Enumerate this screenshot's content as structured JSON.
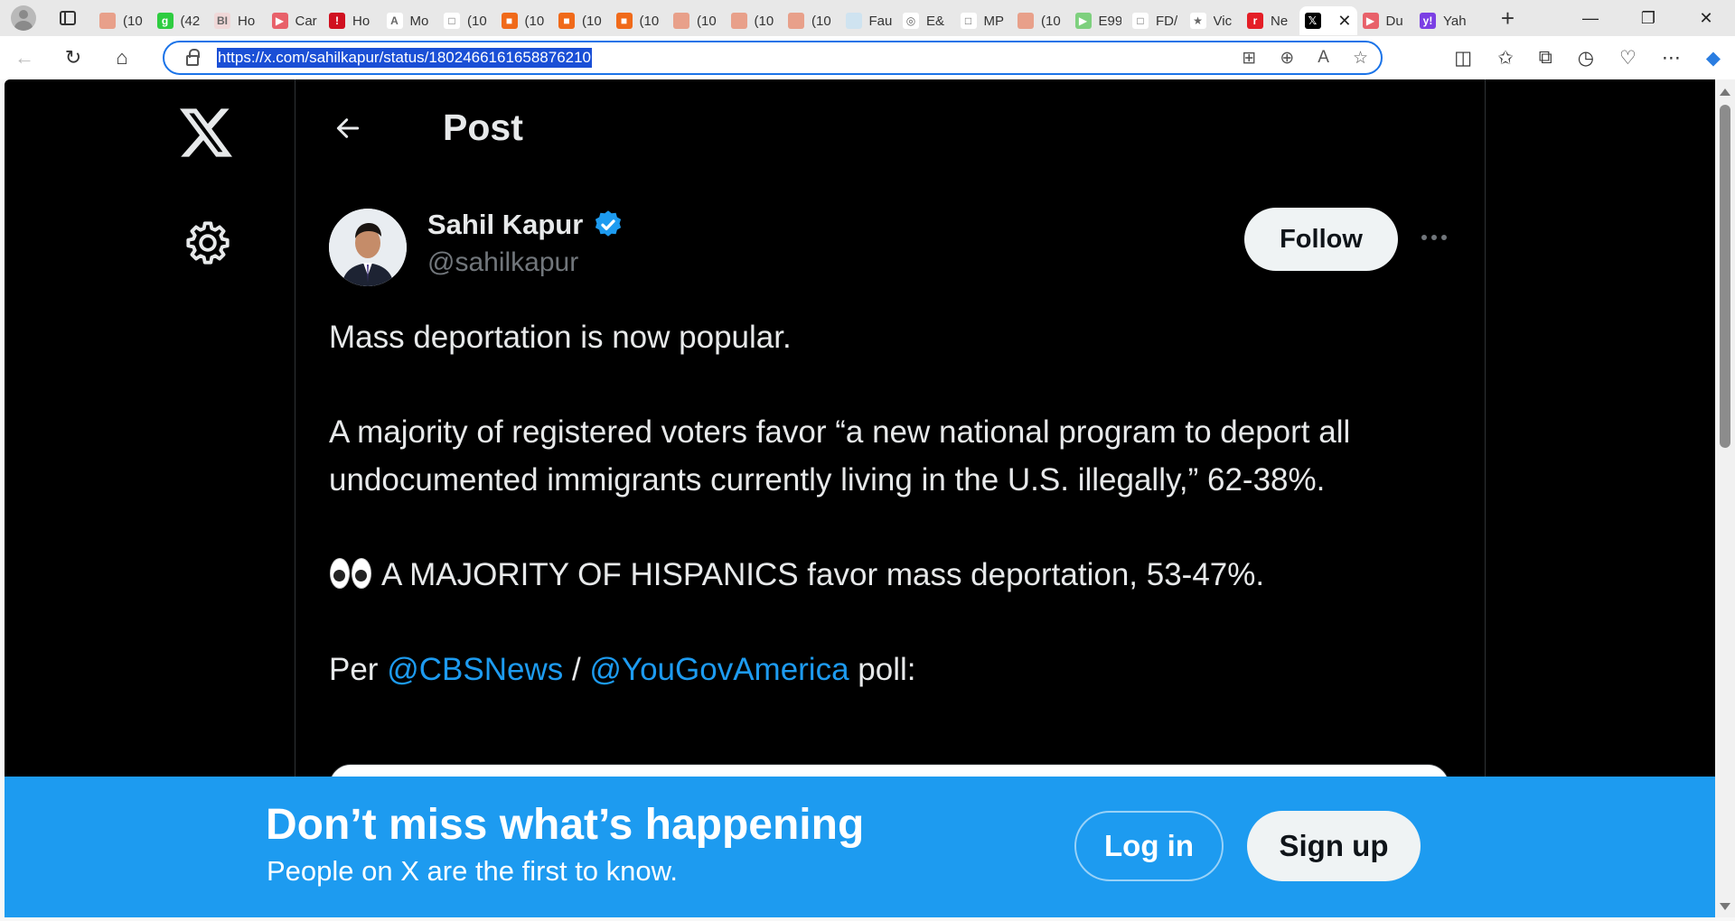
{
  "browser": {
    "tabs": [
      {
        "label": "(10",
        "fav_color": "#e8a08a",
        "fav_glyph": ""
      },
      {
        "label": "(42",
        "fav_color": "#2ecc40",
        "fav_glyph": "g"
      },
      {
        "label": "Ho",
        "fav_color": "#f0d8d8",
        "fav_glyph": "BI"
      },
      {
        "label": "Car",
        "fav_color": "#e8616a",
        "fav_glyph": "▶"
      },
      {
        "label": "Ho",
        "fav_color": "#d01020",
        "fav_glyph": "!"
      },
      {
        "label": "Mo",
        "fav_color": "#ffffff",
        "fav_glyph": "A"
      },
      {
        "label": "(10",
        "fav_color": "#ffffff",
        "fav_glyph": "□"
      },
      {
        "label": "(10",
        "fav_color": "#f06a1a",
        "fav_glyph": "■"
      },
      {
        "label": "(10",
        "fav_color": "#f06a1a",
        "fav_glyph": "■"
      },
      {
        "label": "(10",
        "fav_color": "#f06a1a",
        "fav_glyph": "■"
      },
      {
        "label": "(10",
        "fav_color": "#e8a08a",
        "fav_glyph": ""
      },
      {
        "label": "(10",
        "fav_color": "#e8a08a",
        "fav_glyph": ""
      },
      {
        "label": "(10",
        "fav_color": "#e8a08a",
        "fav_glyph": ""
      },
      {
        "label": "Fau",
        "fav_color": "#cfe3f0",
        "fav_glyph": ""
      },
      {
        "label": "E&",
        "fav_color": "#ffffff",
        "fav_glyph": "◎"
      },
      {
        "label": "MP",
        "fav_color": "#ffffff",
        "fav_glyph": "□"
      },
      {
        "label": "(10",
        "fav_color": "#e8a08a",
        "fav_glyph": ""
      },
      {
        "label": "E99",
        "fav_color": "#7ed07e",
        "fav_glyph": "▶"
      },
      {
        "label": "FD/",
        "fav_color": "#ffffff",
        "fav_glyph": "□"
      },
      {
        "label": "Vic",
        "fav_color": "#ffffff",
        "fav_glyph": "★"
      },
      {
        "label": "Ne",
        "fav_color": "#e41e26",
        "fav_glyph": "r"
      },
      {
        "label": "",
        "fav_color": "#000000",
        "fav_glyph": "𝕏",
        "active": true
      },
      {
        "label": "Du",
        "fav_color": "#e8616a",
        "fav_glyph": "▶"
      },
      {
        "label": "Yah",
        "fav_color": "#7b3fe4",
        "fav_glyph": "y!"
      }
    ],
    "url": "https://x.com/sahilkapur/status/1802466161658876210",
    "window_controls": [
      "—",
      "❐",
      "✕"
    ]
  },
  "nav": {
    "post_title": "Post"
  },
  "tweet": {
    "author_name": "Sahil Kapur",
    "author_handle": "@sahilkapur",
    "follow_label": "Follow",
    "line1": "Mass deportation is now popular.",
    "line2": "A majority of registered voters favor “a new national program to deport all undocumented immigrants currently living in the U.S. illegally,” 62-38%.",
    "line3": "A MAJORITY OF HISPANICS favor mass deportation, 53-47%.",
    "line4_prefix": "Per ",
    "mention1": "@CBSNews",
    "line4_sep": " / ",
    "mention2": "@YouGovAmerica",
    "line4_suffix": " poll:"
  },
  "banner": {
    "title": "Don’t miss what’s happening",
    "subtitle": "People on X are the first to know.",
    "login_label": "Log in",
    "signup_label": "Sign up"
  },
  "colors": {
    "accent": "#1d9bf0",
    "page_bg": "#000000",
    "text_primary": "#e7e9ea",
    "text_secondary": "#71767b"
  }
}
